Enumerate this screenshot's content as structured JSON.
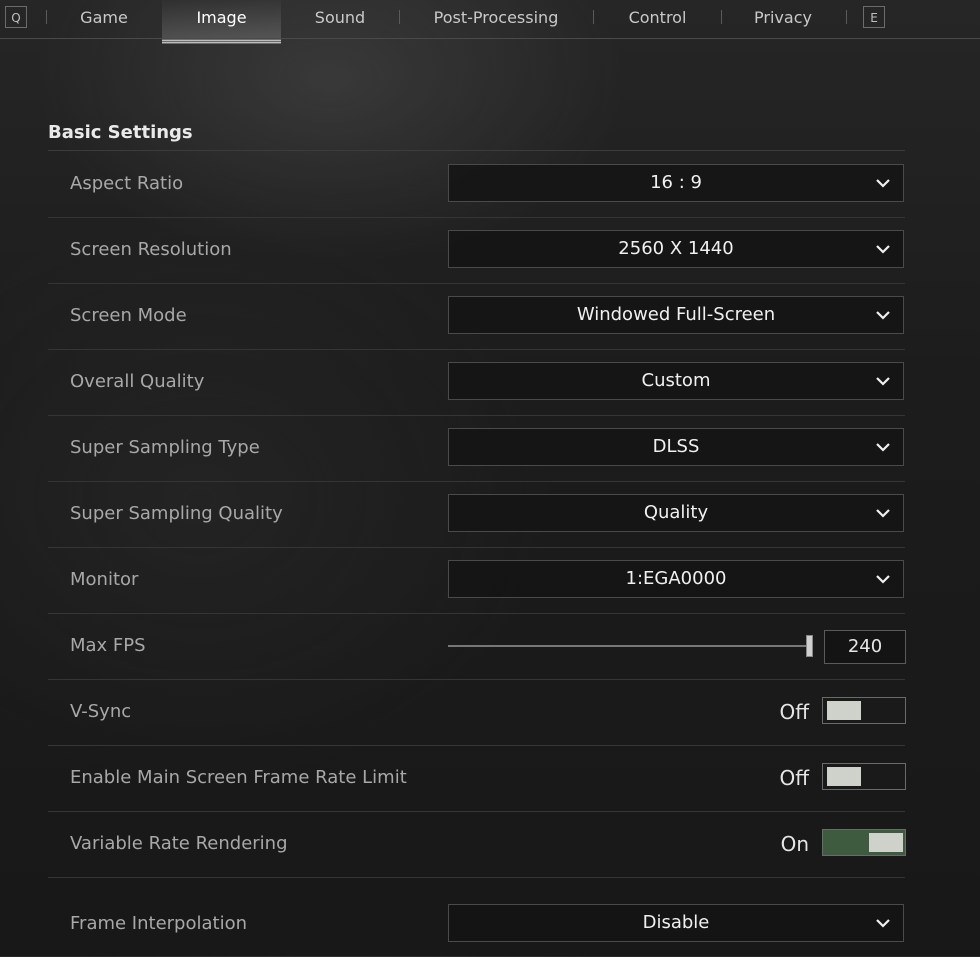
{
  "tabs": {
    "prev_key": "Q",
    "next_key": "E",
    "items": [
      "Game",
      "Image",
      "Sound",
      "Post-Processing",
      "Control",
      "Privacy"
    ],
    "active": "Image"
  },
  "section": {
    "title": "Basic Settings"
  },
  "settings": {
    "aspect_ratio": {
      "label": "Aspect Ratio",
      "value": "16 : 9"
    },
    "screen_resolution": {
      "label": "Screen Resolution",
      "value": "2560 X 1440"
    },
    "screen_mode": {
      "label": "Screen Mode",
      "value": "Windowed Full-Screen"
    },
    "overall_quality": {
      "label": "Overall Quality",
      "value": "Custom"
    },
    "super_sampling_type": {
      "label": "Super Sampling Type",
      "value": "DLSS"
    },
    "super_sampling_quality": {
      "label": "Super Sampling Quality",
      "value": "Quality"
    },
    "monitor": {
      "label": "Monitor",
      "value": "1:EGA0000"
    },
    "max_fps": {
      "label": "Max FPS",
      "value": "240",
      "slider_fraction": 1.0
    },
    "vsync": {
      "label": "V-Sync",
      "state": "Off"
    },
    "main_screen_frame_rate_limit": {
      "label": "Enable Main Screen Frame Rate Limit",
      "state": "Off"
    },
    "variable_rate_rendering": {
      "label": "Variable Rate Rendering",
      "state": "On"
    },
    "frame_interpolation": {
      "label": "Frame Interpolation",
      "value": "Disable"
    }
  },
  "colors": {
    "toggle_on": "#3e5b3f",
    "toggle_knob": "#cfd1cb",
    "text_label": "#a8a8a8"
  }
}
